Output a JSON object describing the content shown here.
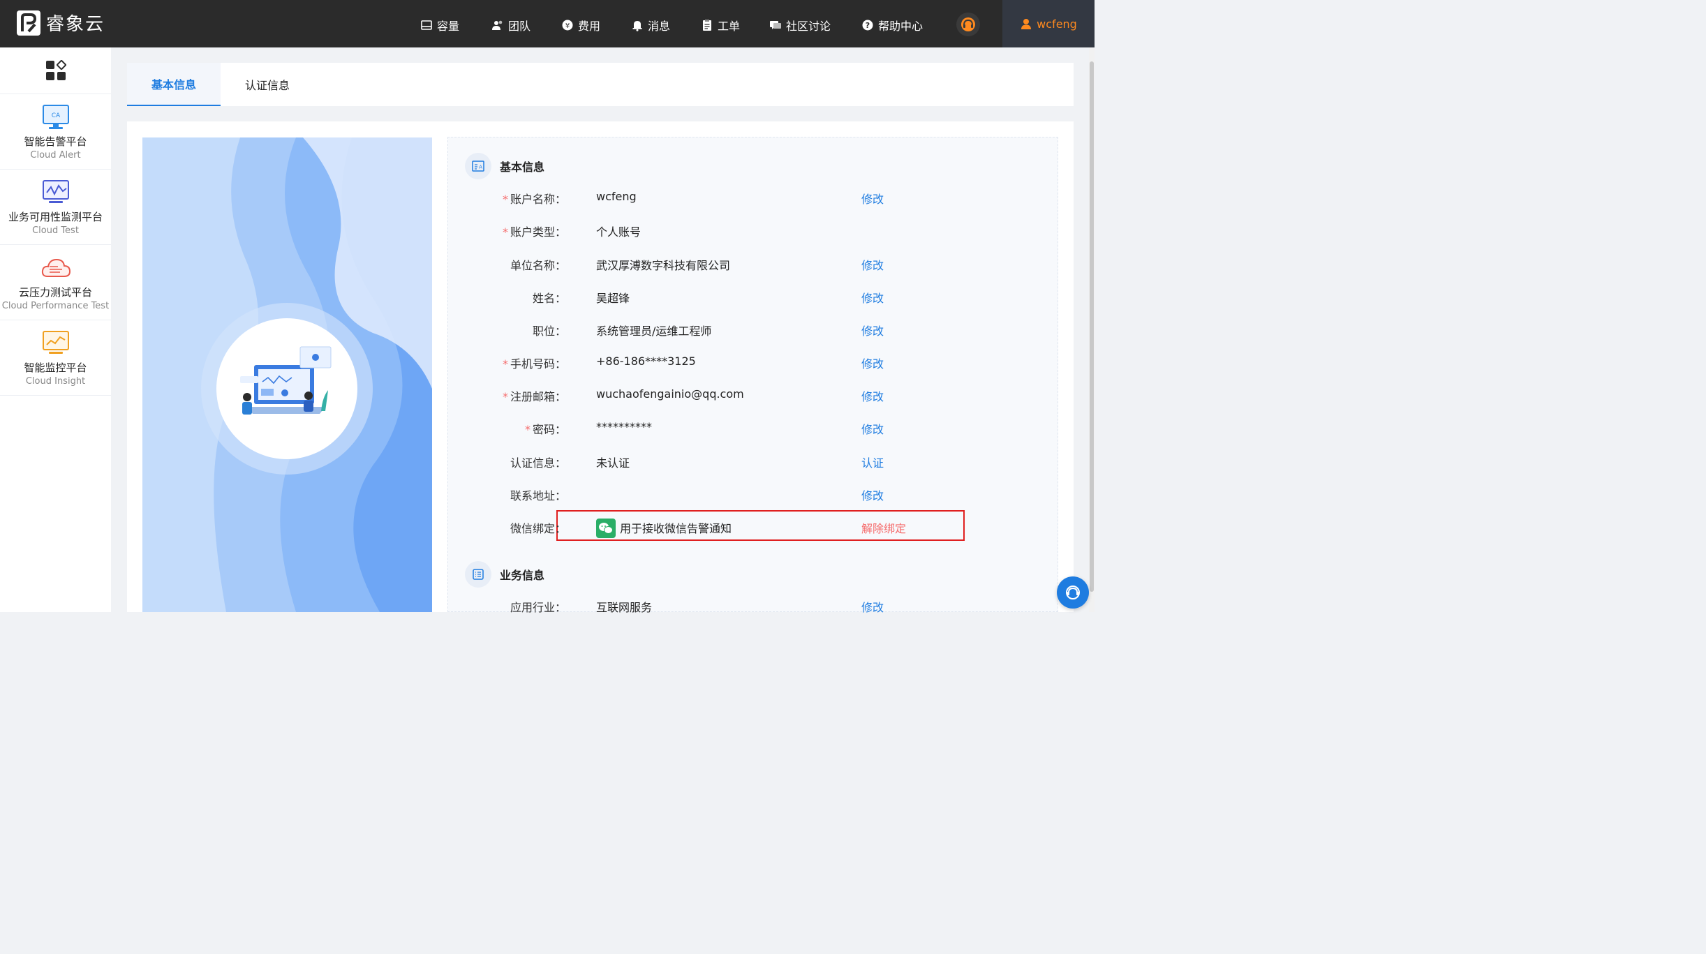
{
  "brand": {
    "name": "睿象云"
  },
  "nav": {
    "items": [
      {
        "label": "容量",
        "icon": "capacity-icon"
      },
      {
        "label": "团队",
        "icon": "team-icon"
      },
      {
        "label": "费用",
        "icon": "cost-icon"
      },
      {
        "label": "消息",
        "icon": "bell-icon"
      },
      {
        "label": "工单",
        "icon": "ticket-icon"
      },
      {
        "label": "社区讨论",
        "icon": "discussion-icon"
      },
      {
        "label": "帮助中心",
        "icon": "help-icon"
      }
    ],
    "user": "wcfeng"
  },
  "sidebar": {
    "items": [
      {
        "cn": "智能告警平台",
        "en": "Cloud Alert"
      },
      {
        "cn": "业务可用性监测平台",
        "en": "Cloud Test"
      },
      {
        "cn": "云压力测试平台",
        "en": "Cloud Performance Test"
      },
      {
        "cn": "智能监控平台",
        "en": "Cloud Insight"
      }
    ]
  },
  "tabs": [
    {
      "label": "基本信息",
      "active": true
    },
    {
      "label": "认证信息",
      "active": false
    }
  ],
  "basic_info": {
    "title": "基本信息",
    "rows": [
      {
        "label": "账户名称：",
        "required": true,
        "value": "wcfeng",
        "action": "修改"
      },
      {
        "label": "账户类型：",
        "required": true,
        "value": "个人账号",
        "action": ""
      },
      {
        "label": "单位名称：",
        "required": false,
        "value": "武汉厚溥数字科技有限公司",
        "action": "修改"
      },
      {
        "label": "姓名：",
        "required": false,
        "value": "吴超锋",
        "action": "修改"
      },
      {
        "label": "职位：",
        "required": false,
        "value": "系统管理员/运维工程师",
        "action": "修改"
      },
      {
        "label": "手机号码：",
        "required": true,
        "value": "+86-186****3125",
        "action": "修改"
      },
      {
        "label": "注册邮箱：",
        "required": true,
        "value": "wuchaofengainio@qq.com",
        "action": "修改"
      },
      {
        "label": "密码：",
        "required": true,
        "value": "**********",
        "action": "修改"
      },
      {
        "label": "认证信息：",
        "required": false,
        "value": "未认证",
        "action": "认证"
      },
      {
        "label": "联系地址：",
        "required": false,
        "value": "",
        "action": "修改"
      }
    ],
    "wechat": {
      "label": "微信绑定：",
      "value": "用于接收微信告警通知",
      "action": "解除绑定"
    }
  },
  "business_info": {
    "title": "业务信息",
    "rows": [
      {
        "label": "应用行业：",
        "value": "互联网服务",
        "action": "修改"
      }
    ]
  },
  "colors": {
    "accent": "#1e7ce0",
    "danger": "#f56c6c",
    "topbar": "#2b2b2b",
    "user": "#ff8a1f"
  }
}
